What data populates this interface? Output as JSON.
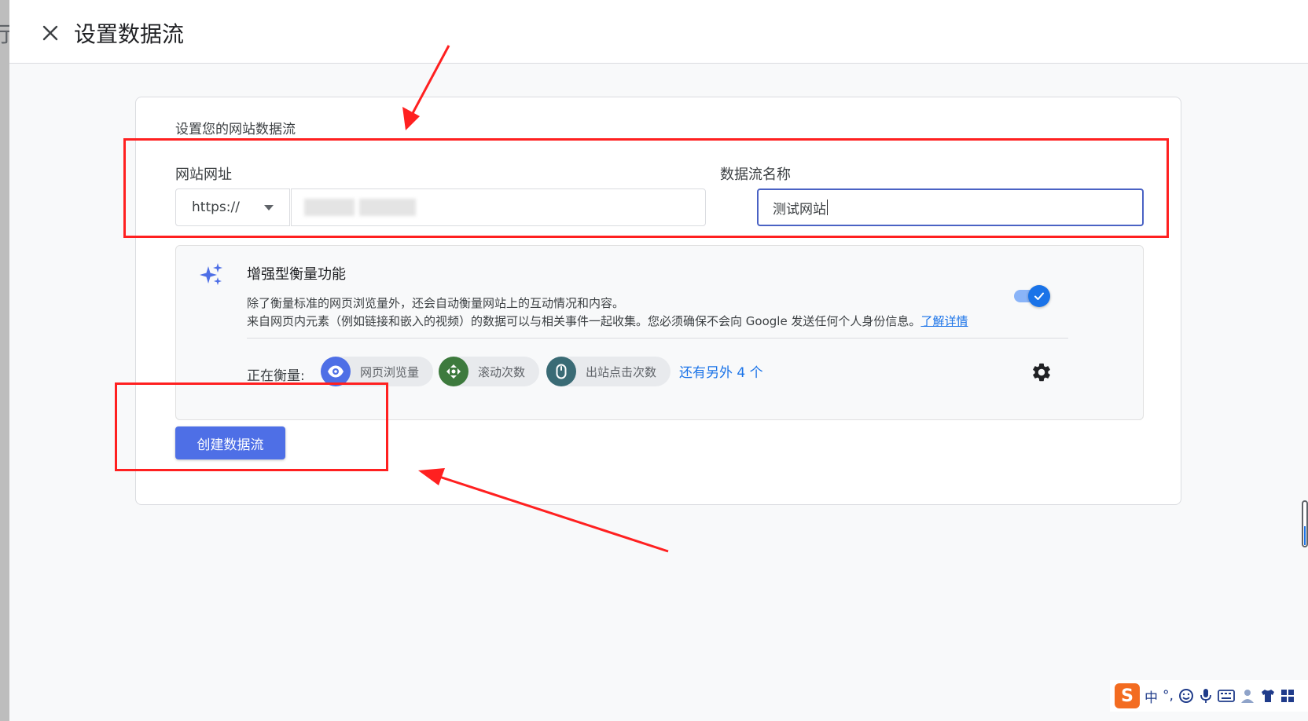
{
  "header": {
    "title": "设置数据流"
  },
  "card": {
    "heading": "设置您的网站数据流",
    "url_label": "网站网址",
    "protocol_value": "https://",
    "stream_name_label": "数据流名称",
    "stream_name_value": "测试网站"
  },
  "enhanced": {
    "title": "增强型衡量功能",
    "desc_line1": "除了衡量标准的网页浏览量外，还会自动衡量网站上的互动情况和内容。",
    "desc_line2": "来自网页内元素（例如链接和嵌入的视频）的数据可以与相关事件一起收集。您必须确保不会向 Google 发送任何个人身份信息。",
    "learn_more": "了解详情",
    "toggle_on": true,
    "measuring_label": "正在衡量:",
    "chips": [
      {
        "label": "网页浏览量",
        "icon": "eye-icon",
        "color": "#4e6fe6"
      },
      {
        "label": "滚动次数",
        "icon": "scroll-target-icon",
        "color": "#3d7a3d"
      },
      {
        "label": "出站点击次数",
        "icon": "mouse-icon",
        "color": "#3a6b75"
      }
    ],
    "more_link": "还有另外 4 个"
  },
  "actions": {
    "create_label": "创建数据流"
  },
  "ime": {
    "logo": "S",
    "mode": "中",
    "punct": "°,"
  },
  "colors": {
    "primary": "#1a73e8",
    "button": "#4e6fe6",
    "annotation": "#ff2020"
  }
}
